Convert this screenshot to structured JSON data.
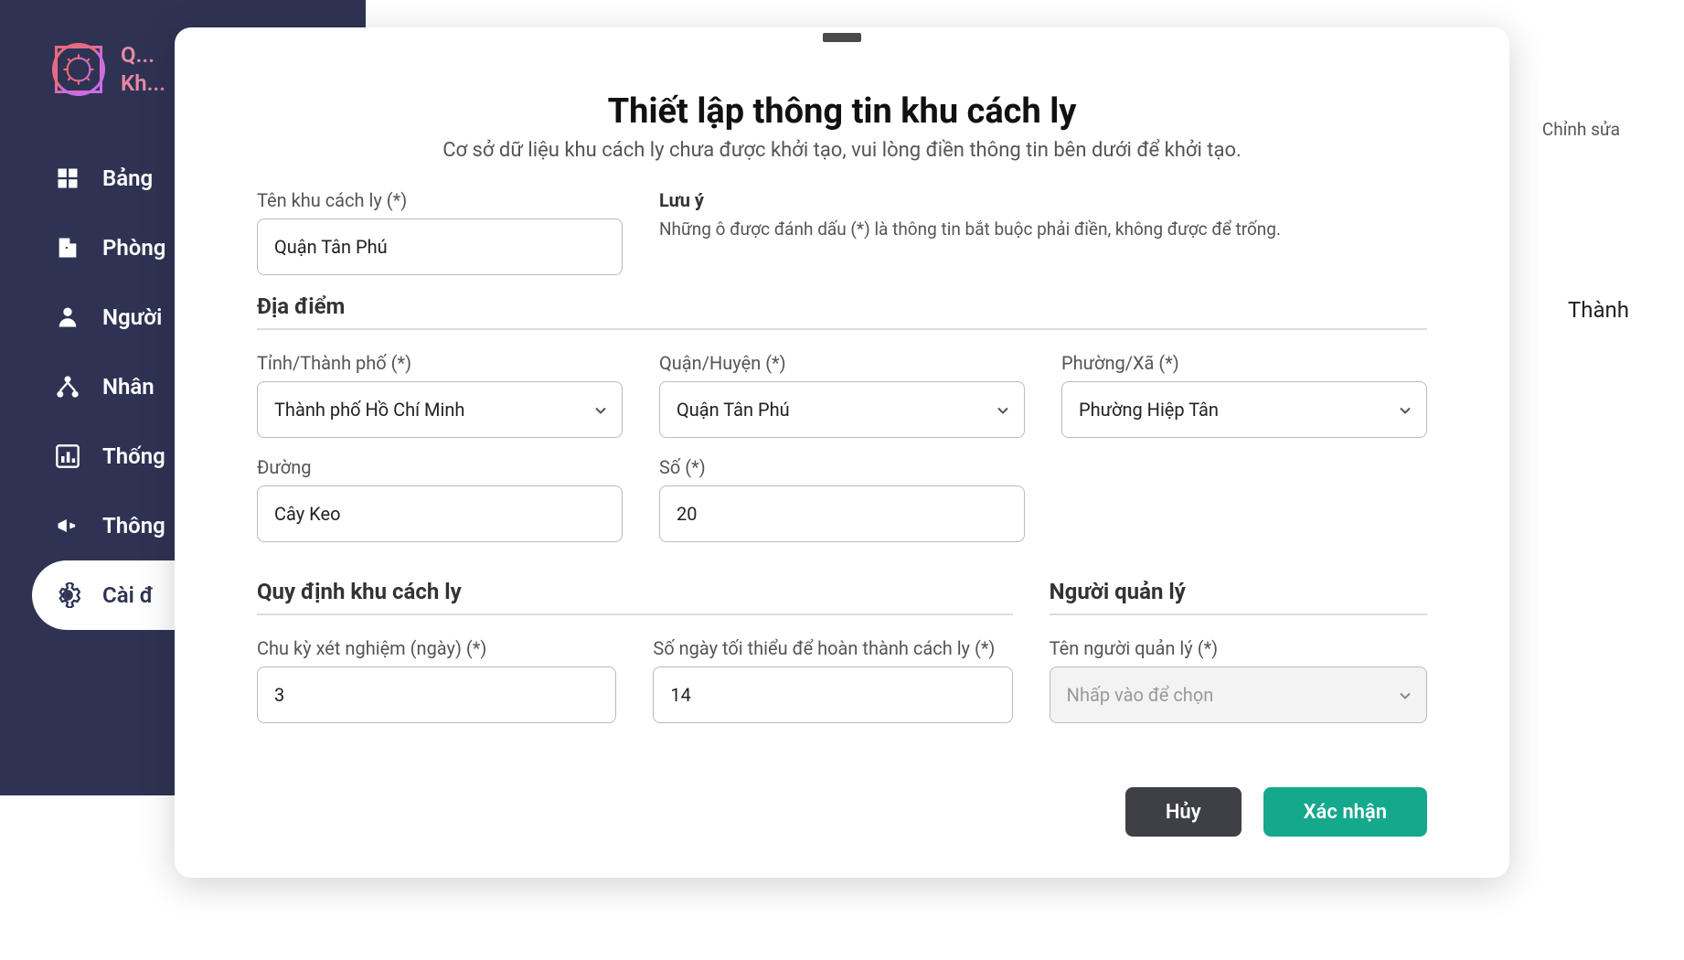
{
  "app": {
    "logo_line1": "Q...",
    "logo_line2": "Kh..."
  },
  "sidebar": {
    "items": [
      {
        "label": "Bảng",
        "icon": "dashboard"
      },
      {
        "label": "Phòng",
        "icon": "door"
      },
      {
        "label": "Người",
        "icon": "person"
      },
      {
        "label": "Nhân",
        "icon": "org"
      },
      {
        "label": "Thống",
        "icon": "chart"
      },
      {
        "label": "Thông",
        "icon": "megaphone"
      },
      {
        "label": "Cài đ",
        "icon": "gear"
      }
    ]
  },
  "background": {
    "edit": "Chỉnh sửa",
    "city_line": "Thành"
  },
  "modal": {
    "title": "Thiết lập thông tin khu cách ly",
    "subtitle": "Cơ sở dữ liệu khu cách ly chưa được khởi tạo, vui lòng điền thông tin bên dưới để khởi tạo.",
    "name_label": "Tên khu cách ly (*)",
    "name_value": "Quận Tân Phú",
    "note_heading": "Lưu ý",
    "note_text": "Những ô được đánh dấu (*) là thông tin bắt buộc phải điền, không được để trống.",
    "location_header": "Địa điểm",
    "province_label": "Tỉnh/Thành phố (*)",
    "province_value": "Thành phố Hồ Chí Minh",
    "district_label": "Quận/Huyện (*)",
    "district_value": "Quận Tân Phú",
    "ward_label": "Phường/Xã (*)",
    "ward_value": "Phường Hiệp Tân",
    "street_label": "Đường",
    "street_value": "Cây Keo",
    "number_label": "Số (*)",
    "number_value": "20",
    "rules_header": "Quy định khu cách ly",
    "test_cycle_label": "Chu kỳ xét nghiệm (ngày) (*)",
    "test_cycle_value": "3",
    "min_days_label": "Số ngày tối thiểu để hoàn thành cách ly (*)",
    "min_days_value": "14",
    "manager_header": "Người quản lý",
    "manager_label": "Tên người quản lý (*)",
    "manager_placeholder": "Nhấp vào để chọn",
    "cancel": "Hủy",
    "confirm": "Xác nhận"
  }
}
